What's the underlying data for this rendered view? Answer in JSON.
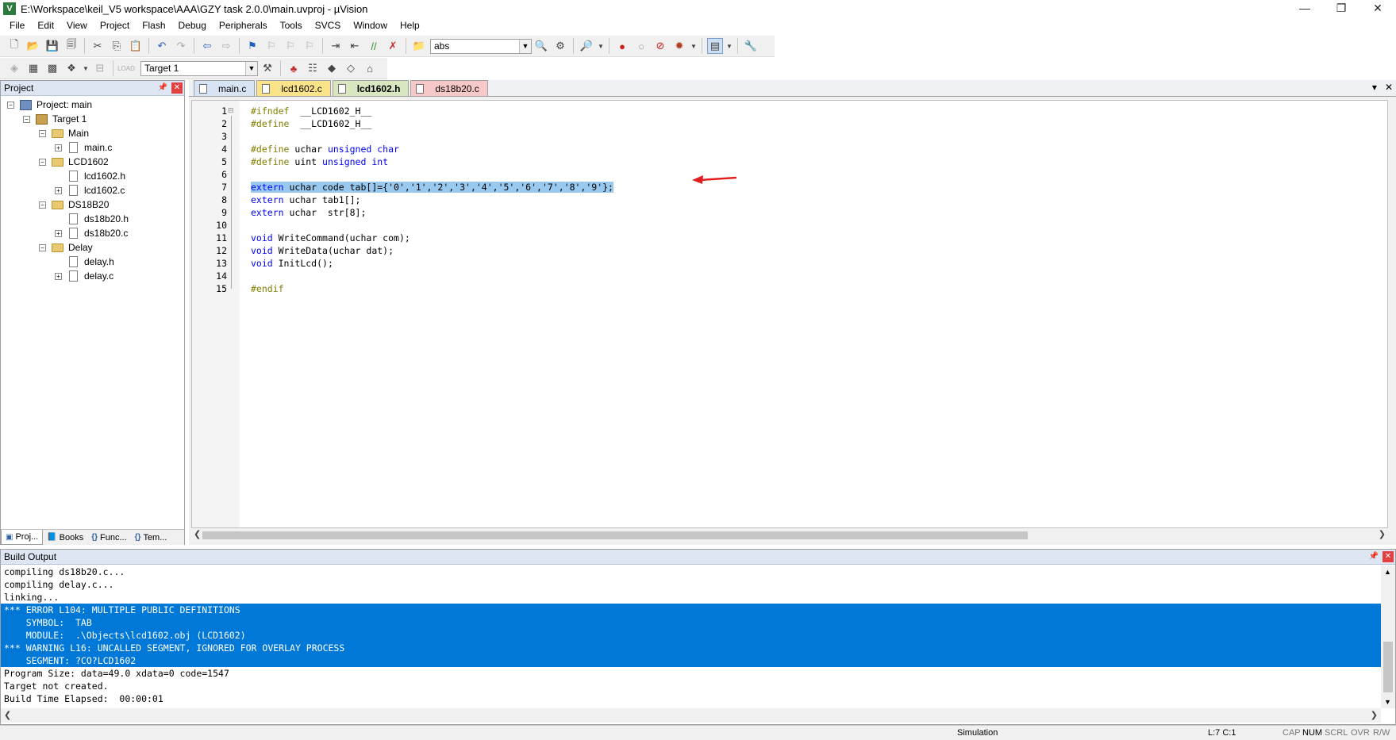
{
  "window": {
    "title": "E:\\Workspace\\keil_V5 workspace\\AAA\\GZY task 2.0.0\\main.uvproj - µVision",
    "app_icon": "V",
    "minimize": "—",
    "restore": "❐",
    "close": "✕"
  },
  "menu": [
    "File",
    "Edit",
    "View",
    "Project",
    "Flash",
    "Debug",
    "Peripherals",
    "Tools",
    "SVCS",
    "Window",
    "Help"
  ],
  "toolbar": {
    "find_value": "abs",
    "target_value": "Target 1"
  },
  "project_panel": {
    "title": "Project",
    "tree": [
      {
        "label": "Project: main",
        "level": 0,
        "type": "project"
      },
      {
        "label": "Target 1",
        "level": 1,
        "type": "target"
      },
      {
        "label": "Main",
        "level": 2,
        "type": "folder"
      },
      {
        "label": "main.c",
        "level": 3,
        "type": "file"
      },
      {
        "label": "LCD1602",
        "level": 2,
        "type": "folder"
      },
      {
        "label": "lcd1602.h",
        "level": 3,
        "type": "file"
      },
      {
        "label": "lcd1602.c",
        "level": 3,
        "type": "file"
      },
      {
        "label": "DS18B20",
        "level": 2,
        "type": "folder"
      },
      {
        "label": "ds18b20.h",
        "level": 3,
        "type": "file"
      },
      {
        "label": "ds18b20.c",
        "level": 3,
        "type": "file"
      },
      {
        "label": "Delay",
        "level": 2,
        "type": "folder"
      },
      {
        "label": "delay.h",
        "level": 3,
        "type": "file"
      },
      {
        "label": "delay.c",
        "level": 3,
        "type": "file"
      }
    ],
    "tabs": [
      "Proj...",
      "Books",
      "Func...",
      "Tem..."
    ]
  },
  "editor": {
    "tabs": [
      {
        "label": "main.c",
        "color": "#d8e4f4"
      },
      {
        "label": "lcd1602.c",
        "color": "#fbe38a"
      },
      {
        "label": "lcd1602.h",
        "color": "#d8e7c0",
        "active": true
      },
      {
        "label": "ds18b20.c",
        "color": "#f6c8c8"
      }
    ],
    "tab_menu": "▾",
    "tab_close": "✕",
    "highlighted_line": 7,
    "line_numbers": [
      "1",
      "2",
      "3",
      "4",
      "5",
      "6",
      "7",
      "8",
      "9",
      "10",
      "11",
      "12",
      "13",
      "14",
      "15"
    ],
    "lines": [
      [
        [
          "pp",
          "#ifndef"
        ],
        [
          "",
          "  __LCD1602_H__"
        ]
      ],
      [
        [
          "pp",
          "#define"
        ],
        [
          "",
          "  __LCD1602_H__"
        ]
      ],
      [],
      [
        [
          "pp",
          "#define"
        ],
        [
          "",
          " uchar "
        ],
        [
          "kw",
          "unsigned char"
        ]
      ],
      [
        [
          "pp",
          "#define"
        ],
        [
          "",
          " uint "
        ],
        [
          "kw",
          "unsigned int"
        ]
      ],
      [],
      [
        [
          "kw",
          "extern"
        ],
        [
          "",
          " uchar code tab[]={'0','1','2','3','4','5','6','7','8','9'};"
        ]
      ],
      [
        [
          "kw",
          "extern"
        ],
        [
          "",
          " uchar tab1[];"
        ]
      ],
      [
        [
          "kw",
          "extern"
        ],
        [
          "",
          " uchar  str[8];"
        ]
      ],
      [],
      [
        [
          "kw",
          "void"
        ],
        [
          "",
          " WriteCommand(uchar com);"
        ]
      ],
      [
        [
          "kw",
          "void"
        ],
        [
          "",
          " WriteData(uchar dat);"
        ]
      ],
      [
        [
          "kw",
          "void"
        ],
        [
          "",
          " InitLcd();"
        ]
      ],
      [],
      [
        [
          "pp",
          "#endif"
        ]
      ]
    ]
  },
  "build_output": {
    "title": "Build Output",
    "lines": [
      {
        "text": "compiling ds18b20.c...",
        "selected": false
      },
      {
        "text": "compiling delay.c...",
        "selected": false
      },
      {
        "text": "linking...",
        "selected": false
      },
      {
        "text": "*** ERROR L104: MULTIPLE PUBLIC DEFINITIONS",
        "selected": true
      },
      {
        "text": "    SYMBOL:  TAB",
        "selected": true
      },
      {
        "text": "    MODULE:  .\\Objects\\lcd1602.obj (LCD1602)",
        "selected": true
      },
      {
        "text": "*** WARNING L16: UNCALLED SEGMENT, IGNORED FOR OVERLAY PROCESS",
        "selected": true
      },
      {
        "text": "    SEGMENT: ?CO?LCD1602",
        "selected": true
      },
      {
        "text": "Program Size: data=49.0 xdata=0 code=1547",
        "selected": false
      },
      {
        "text": "Target not created.",
        "selected": false
      },
      {
        "text": "Build Time Elapsed:  00:00:01",
        "selected": false
      }
    ]
  },
  "status": {
    "mode": "Simulation",
    "cursor": "L:7 C:1",
    "cap": "CAP",
    "num": "NUM",
    "scrl": "SCRL",
    "ovr": "OVR",
    "rw": "R/W"
  },
  "colors": {
    "selection": "#0078d7",
    "code_highlight": "#99c9ef",
    "keyword": "#0000ff",
    "preprocessor": "#808000",
    "annotation_arrow": "#e02020"
  }
}
